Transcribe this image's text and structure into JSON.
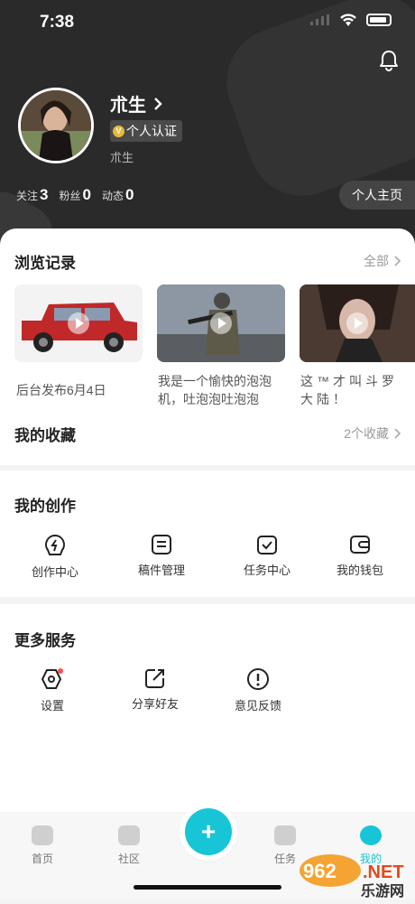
{
  "status": {
    "time": "7:38"
  },
  "profile": {
    "name": "朮生",
    "verify_label": "个人认证",
    "verify_badge": "V",
    "subname": "朮生",
    "homepage_label": "个人主页"
  },
  "stats": [
    {
      "label": "关注",
      "value": "3"
    },
    {
      "label": "粉丝",
      "value": "0"
    },
    {
      "label": "动态",
      "value": "0"
    }
  ],
  "history": {
    "title": "浏览记录",
    "more": "全部",
    "items": [
      {
        "caption": "后台发布6月4日"
      },
      {
        "caption": "我是一个愉快的泡泡机，吐泡泡吐泡泡"
      },
      {
        "caption": "这™才叫斗罗大陆！"
      }
    ]
  },
  "favorites": {
    "title": "我的收藏",
    "count": "2个收藏"
  },
  "creation": {
    "title": "我的创作",
    "items": [
      {
        "label": "创作中心",
        "icon": "creation-center-icon"
      },
      {
        "label": "稿件管理",
        "icon": "manuscript-icon"
      },
      {
        "label": "任务中心",
        "icon": "task-center-icon"
      },
      {
        "label": "我的钱包",
        "icon": "wallet-icon"
      }
    ]
  },
  "services": {
    "title": "更多服务",
    "items": [
      {
        "label": "设置",
        "icon": "settings-icon"
      },
      {
        "label": "分享好友",
        "icon": "share-icon"
      },
      {
        "label": "意见反馈",
        "icon": "feedback-icon"
      }
    ]
  },
  "tabbar": {
    "items": [
      {
        "label": "首页"
      },
      {
        "label": "社区"
      },
      {
        "label": "任务"
      },
      {
        "label": "我的"
      }
    ],
    "fab": "+"
  },
  "watermark": {
    "text": "962.NET",
    "sub": "乐游网"
  },
  "colors": {
    "accent": "#18c5d6",
    "header_bg": "#2a2a2a"
  }
}
